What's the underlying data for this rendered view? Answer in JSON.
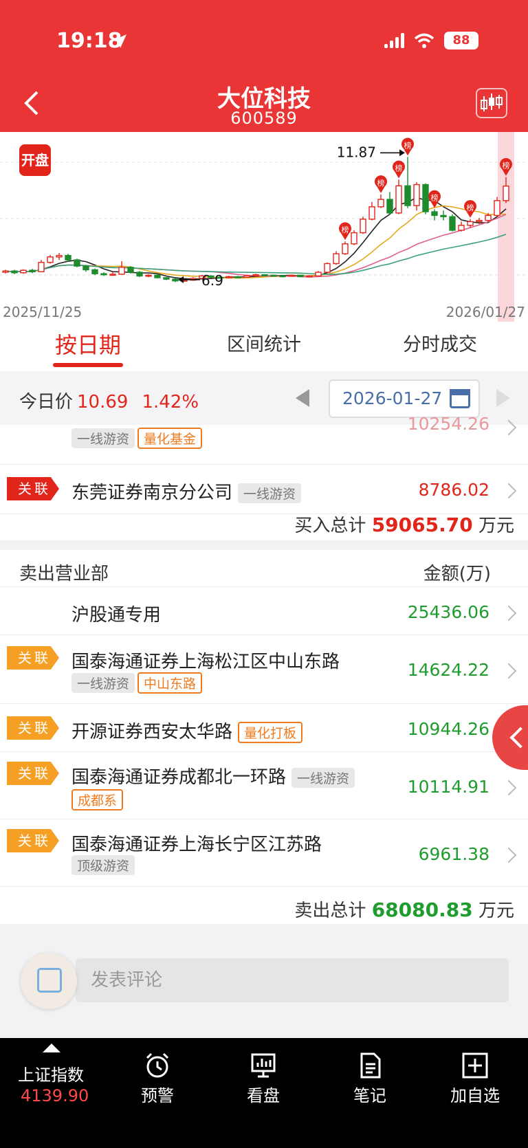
{
  "status": {
    "time": "19:18",
    "battery": "88"
  },
  "header": {
    "title": "大位科技",
    "code": "600589"
  },
  "chart": {
    "badge": "开盘",
    "date_start": "2025/11/25",
    "date_end": "2026/01/27",
    "high_label": "11.87",
    "low_label": "6.9",
    "marker": "榜",
    "colors": {
      "up": "#e1251b",
      "down": "#1e8c2e"
    }
  },
  "chart_data": {
    "type": "candlestick",
    "x": [
      "2025/11/25",
      "2026/01/27"
    ],
    "annotations": [
      {
        "label": "11.87",
        "value": 11.87
      },
      {
        "label": "6.9",
        "value": 6.9
      }
    ],
    "candles": [
      [
        7.2,
        7.25,
        7.15,
        7.3
      ],
      [
        7.25,
        7.18,
        7.12,
        7.3
      ],
      [
        7.18,
        7.28,
        7.14,
        7.32
      ],
      [
        7.28,
        7.22,
        7.16,
        7.34
      ],
      [
        7.22,
        7.6,
        7.2,
        7.7
      ],
      [
        7.6,
        7.82,
        7.55,
        7.9
      ],
      [
        7.82,
        7.88,
        7.7,
        7.98
      ],
      [
        7.88,
        7.7,
        7.62,
        7.95
      ],
      [
        7.7,
        7.45,
        7.4,
        7.75
      ],
      [
        7.45,
        7.3,
        7.22,
        7.5
      ],
      [
        7.3,
        7.14,
        7.08,
        7.35
      ],
      [
        7.14,
        7.1,
        7.05,
        7.2
      ],
      [
        7.1,
        7.12,
        7.05,
        7.22
      ],
      [
        7.12,
        7.4,
        7.1,
        7.65
      ],
      [
        7.4,
        7.2,
        7.15,
        7.45
      ],
      [
        7.2,
        7.05,
        7.0,
        7.25
      ],
      [
        7.05,
        7.08,
        7.0,
        7.12
      ],
      [
        7.08,
        6.98,
        6.95,
        7.12
      ],
      [
        6.98,
        6.92,
        6.88,
        7.0
      ],
      [
        6.92,
        6.85,
        6.8,
        6.95
      ],
      [
        6.85,
        6.88,
        6.82,
        6.92
      ],
      [
        6.88,
        6.95,
        6.86,
        7.0
      ],
      [
        6.95,
        7.05,
        6.92,
        7.1
      ],
      [
        7.05,
        7.0,
        6.96,
        7.08
      ],
      [
        7.0,
        6.98,
        6.95,
        7.04
      ],
      [
        6.98,
        7.02,
        6.96,
        7.06
      ],
      [
        7.02,
        7.0,
        6.98,
        7.05
      ],
      [
        7.0,
        7.06,
        6.98,
        7.1
      ],
      [
        7.06,
        7.1,
        7.02,
        7.14
      ],
      [
        7.1,
        7.08,
        7.04,
        7.12
      ],
      [
        7.08,
        7.06,
        7.02,
        7.1
      ],
      [
        7.06,
        7.04,
        7.0,
        7.08
      ],
      [
        7.04,
        7.08,
        7.02,
        7.1
      ],
      [
        7.08,
        7.02,
        7.0,
        7.1
      ],
      [
        7.02,
        7.05,
        7.0,
        7.08
      ],
      [
        7.05,
        7.2,
        7.03,
        7.25
      ],
      [
        7.2,
        7.55,
        7.18,
        7.6
      ],
      [
        7.55,
        7.95,
        7.5,
        8.05
      ],
      [
        7.95,
        8.35,
        7.9,
        8.45
      ],
      [
        8.35,
        8.8,
        8.3,
        8.9
      ],
      [
        8.8,
        9.35,
        8.75,
        9.45
      ],
      [
        9.35,
        9.85,
        9.3,
        10.05
      ],
      [
        9.85,
        10.15,
        9.8,
        10.35
      ],
      [
        10.15,
        9.6,
        9.55,
        10.45
      ],
      [
        9.6,
        10.7,
        9.55,
        10.95
      ],
      [
        10.7,
        9.9,
        9.8,
        11.87
      ],
      [
        9.9,
        10.75,
        9.7,
        10.85
      ],
      [
        10.75,
        9.65,
        9.55,
        10.8
      ],
      [
        9.65,
        9.5,
        9.3,
        9.75
      ],
      [
        9.5,
        9.45,
        9.3,
        9.7
      ],
      [
        9.45,
        8.9,
        8.85,
        9.55
      ],
      [
        8.9,
        9.1,
        8.85,
        9.25
      ],
      [
        9.1,
        9.25,
        9.0,
        9.35
      ],
      [
        9.25,
        9.3,
        9.15,
        9.4
      ],
      [
        9.3,
        9.5,
        9.2,
        9.6
      ],
      [
        9.5,
        10.1,
        9.45,
        10.25
      ],
      [
        10.1,
        10.69,
        10.0,
        11.05
      ]
    ]
  },
  "tabs": [
    {
      "label": "按日期",
      "active": true
    },
    {
      "label": "区间统计",
      "active": false
    },
    {
      "label": "分时成交",
      "active": false
    }
  ],
  "datebar": {
    "label": "今日价",
    "price": "10.69",
    "pct": "1.42%",
    "date": "2026-01-27"
  },
  "buy_partial": {
    "tag1": "一线游资",
    "tag2": "量化基金",
    "amount": "10254.26"
  },
  "buy_last": {
    "badge": "关联",
    "name": "东莞证券南京分公司",
    "tag": "一线游资",
    "amount": "8786.02"
  },
  "buy_total": {
    "label": "买入总计",
    "value": "59065.70",
    "unit": "万元"
  },
  "sell_header": {
    "title": "卖出营业部",
    "amount_col": "金额(万)"
  },
  "sell_rows": [
    {
      "name": "沪股通专用",
      "amount": "25436.06"
    },
    {
      "badge": "关联",
      "name": "国泰海通证券上海松江区中山东路",
      "tag1": "一线游资",
      "tag2": "中山东路",
      "amount": "14624.22"
    },
    {
      "badge": "关联",
      "name": "开源证券西安太华路",
      "tag2": "量化打板",
      "amount": "10944.26"
    },
    {
      "badge": "关联",
      "name": "国泰海通证券成都北一环路",
      "tag1": "一线游资",
      "tag2": "成都系",
      "amount": "10114.91"
    },
    {
      "badge": "关联",
      "name": "国泰海通证券上海长宁区江苏路",
      "tag1": "顶级游资",
      "amount": "6961.38"
    }
  ],
  "sell_total": {
    "label": "卖出总计",
    "value": "68080.83",
    "unit": "万元"
  },
  "comment": {
    "placeholder": "发表评论"
  },
  "nav": {
    "index_name": "上证指数",
    "index_value": "4139.90",
    "items": [
      {
        "label": "预警",
        "icon": "alarm-clock-icon"
      },
      {
        "label": "看盘",
        "icon": "monitor-chart-icon"
      },
      {
        "label": "笔记",
        "icon": "notes-icon"
      },
      {
        "label": "加自选",
        "icon": "add-favorite-icon"
      }
    ]
  }
}
